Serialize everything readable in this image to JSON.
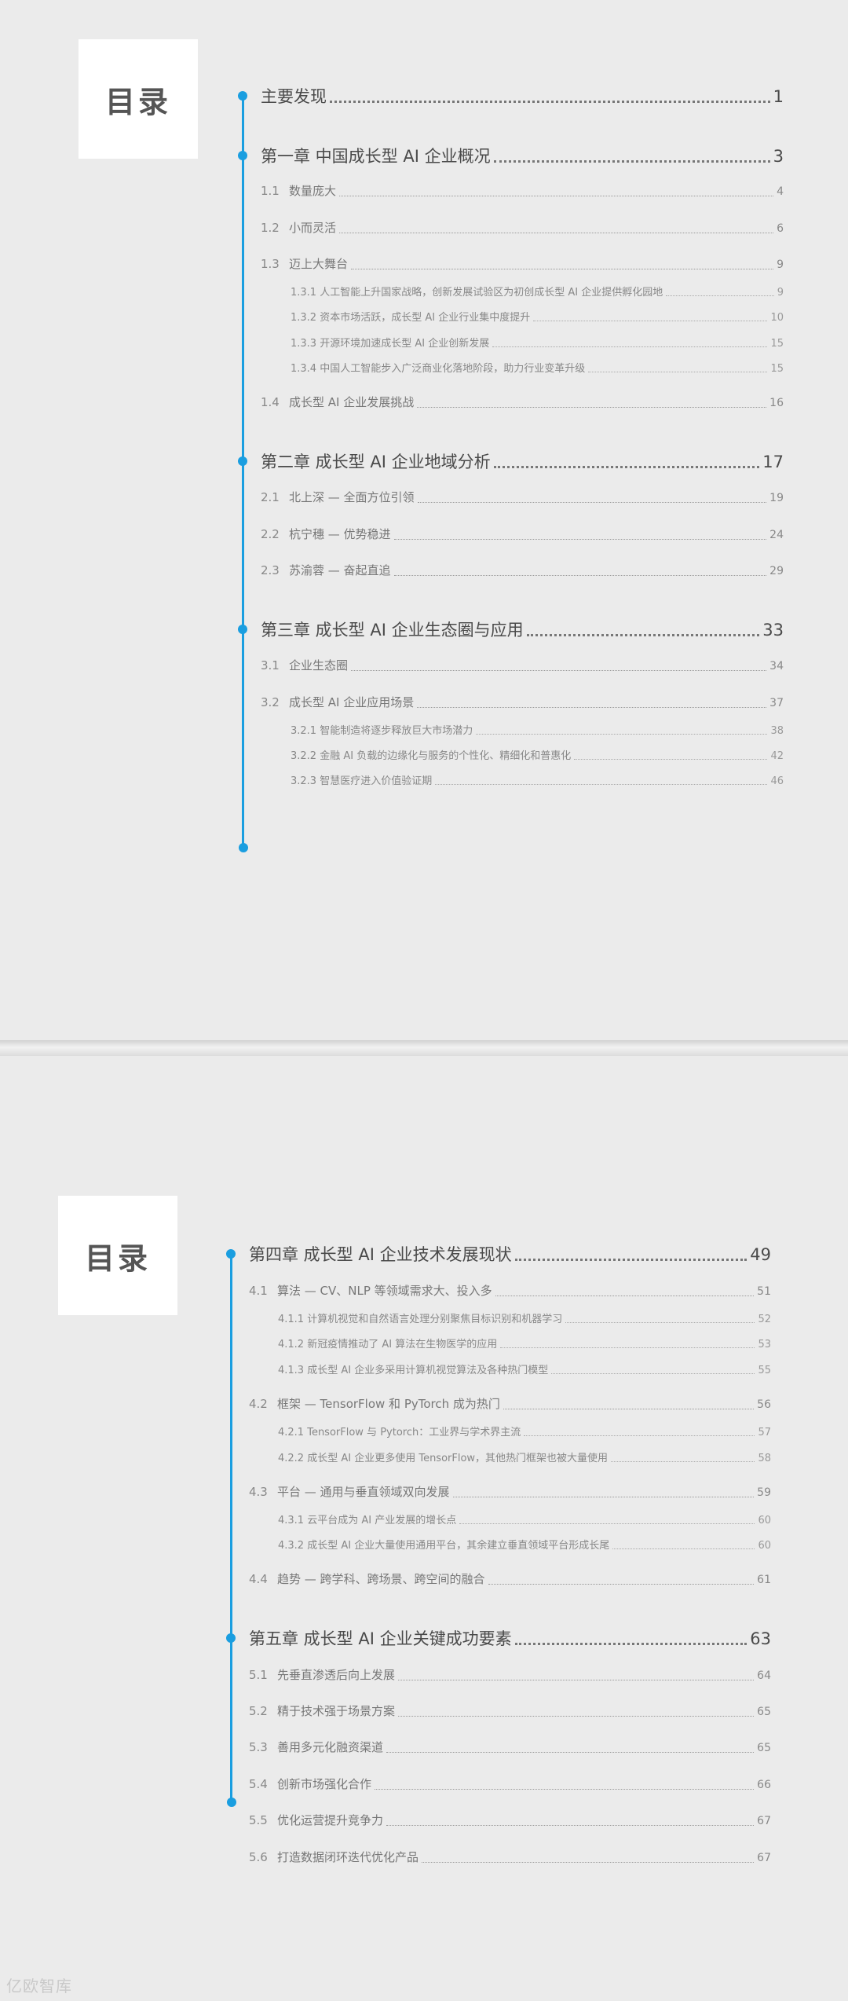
{
  "toc_title": "目录",
  "watermark": "亿欧智库",
  "pages": [
    {
      "entries": [
        {
          "level": 1,
          "code": "",
          "label": "主要发现",
          "page": "1"
        },
        {
          "level": 1,
          "code": "",
          "label": "第一章  中国成长型 AI 企业概况",
          "page": "3"
        },
        {
          "level": 2,
          "code": "1.1",
          "label": "数量庞大",
          "page": "4"
        },
        {
          "level": 2,
          "code": "1.2",
          "label": "小而灵活",
          "page": "6"
        },
        {
          "level": 2,
          "code": "1.3",
          "label": "迈上大舞台",
          "page": "9"
        },
        {
          "level": 3,
          "code": "",
          "label": "1.3.1 人工智能上升国家战略，创新发展试验区为初创成长型 AI 企业提供孵化园地",
          "page": "9"
        },
        {
          "level": 3,
          "code": "",
          "label": "1.3.2 资本市场活跃，成长型 AI 企业行业集中度提升",
          "page": "10"
        },
        {
          "level": 3,
          "code": "",
          "label": "1.3.3 开源环境加速成长型 AI 企业创新发展",
          "page": "15"
        },
        {
          "level": 3,
          "code": "",
          "label": "1.3.4 中国人工智能步入广泛商业化落地阶段，助力行业变革升级",
          "page": "15"
        },
        {
          "level": 2,
          "code": "1.4",
          "label": "成长型 AI 企业发展挑战",
          "page": "16"
        },
        {
          "level": 1,
          "code": "",
          "label": "第二章  成长型 AI 企业地域分析",
          "page": "17"
        },
        {
          "level": 2,
          "code": "2.1",
          "label": "北上深 — 全面方位引领",
          "page": "19"
        },
        {
          "level": 2,
          "code": "2.2",
          "label": "杭宁穗 — 优势稳进",
          "page": "24"
        },
        {
          "level": 2,
          "code": "2.3",
          "label": "苏渝蓉 — 奋起直追",
          "page": "29"
        },
        {
          "level": 1,
          "code": "",
          "label": "第三章  成长型 AI 企业生态圈与应用",
          "page": "33"
        },
        {
          "level": 2,
          "code": "3.1",
          "label": "企业生态圈",
          "page": "34"
        },
        {
          "level": 2,
          "code": "3.2",
          "label": "成长型 AI 企业应用场景",
          "page": "37"
        },
        {
          "level": 3,
          "code": "",
          "label": "3.2.1 智能制造将逐步释放巨大市场潜力",
          "page": "38"
        },
        {
          "level": 3,
          "code": "",
          "label": "3.2.2 金融 AI 负载的边缘化与服务的个性化、精细化和普惠化",
          "page": "42"
        },
        {
          "level": 3,
          "code": "",
          "label": "3.2.3 智慧医疗进入价值验证期",
          "page": "46"
        }
      ]
    },
    {
      "entries": [
        {
          "level": 1,
          "code": "",
          "label": "第四章  成长型 AI 企业技术发展现状",
          "page": "49"
        },
        {
          "level": 2,
          "code": "4.1",
          "label": "算法 — CV、NLP 等领域需求大、投入多",
          "page": "51"
        },
        {
          "level": 3,
          "code": "",
          "label": "4.1.1 计算机视觉和自然语言处理分别聚焦目标识别和机器学习",
          "page": "52"
        },
        {
          "level": 3,
          "code": "",
          "label": "4.1.2 新冠疫情推动了 AI 算法在生物医学的应用",
          "page": "53"
        },
        {
          "level": 3,
          "code": "",
          "label": "4.1.3 成长型 AI 企业多采用计算机视觉算法及各种热门模型",
          "page": "55"
        },
        {
          "level": 2,
          "code": "4.2",
          "label": "框架 — TensorFlow 和 PyTorch 成为热门",
          "page": "56"
        },
        {
          "level": 3,
          "code": "",
          "label": "4.2.1 TensorFlow 与 Pytorch：工业界与学术界主流",
          "page": "57"
        },
        {
          "level": 3,
          "code": "",
          "label": "4.2.2 成长型 AI 企业更多使用 TensorFlow，其他热门框架也被大量使用",
          "page": "58"
        },
        {
          "level": 2,
          "code": "4.3",
          "label": "平台 — 通用与垂直领域双向发展",
          "page": "59"
        },
        {
          "level": 3,
          "code": "",
          "label": "4.3.1 云平台成为 AI 产业发展的增长点",
          "page": "60"
        },
        {
          "level": 3,
          "code": "",
          "label": "4.3.2 成长型 AI 企业大量使用通用平台，其余建立垂直领域平台形成长尾",
          "page": "60"
        },
        {
          "level": 2,
          "code": "4.4",
          "label": "趋势 — 跨学科、跨场景、跨空间的融合",
          "page": "61"
        },
        {
          "level": 1,
          "code": "",
          "label": "第五章  成长型 AI 企业关键成功要素",
          "page": "63"
        },
        {
          "level": 2,
          "code": "5.1",
          "label": "先垂直渗透后向上发展",
          "page": "64"
        },
        {
          "level": 2,
          "code": "5.2",
          "label": "精于技术强于场景方案",
          "page": "65"
        },
        {
          "level": 2,
          "code": "5.3",
          "label": "善用多元化融资渠道",
          "page": "65"
        },
        {
          "level": 2,
          "code": "5.4",
          "label": "创新市场强化合作",
          "page": "66"
        },
        {
          "level": 2,
          "code": "5.5",
          "label": "优化运营提升竞争力",
          "page": "67"
        },
        {
          "level": 2,
          "code": "5.6",
          "label": "打造数据闭环迭代优化产品",
          "page": "67"
        }
      ]
    }
  ]
}
